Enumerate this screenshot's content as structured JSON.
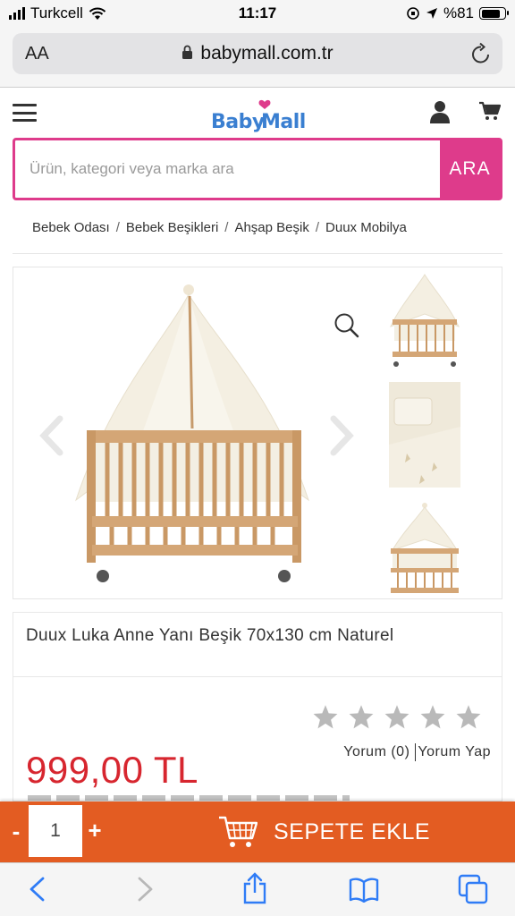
{
  "status_bar": {
    "carrier": "Turkcell",
    "time": "11:17",
    "battery": "%81"
  },
  "browser": {
    "text_size_label": "AA",
    "url": "babymall.com.tr"
  },
  "header": {
    "logo_text": "Baby Mall"
  },
  "search": {
    "placeholder": "Ürün, kategori veya marka ara",
    "button_label": "ARA",
    "accent_color": "#de3b8b"
  },
  "breadcrumb": [
    "Bebek Odası",
    "Bebek Beşikleri",
    "Ahşap Beşik",
    "Duux Mobilya"
  ],
  "product": {
    "title": "Duux Luka Anne Yanı Beşik 70x130 cm Naturel",
    "price": "999,00 TL",
    "price_color": "#d7262f",
    "rating": 0,
    "review_label": "Yorum (0)",
    "write_review_label": "Yorum Yap"
  },
  "cart_bar": {
    "quantity": "1",
    "minus_label": "-",
    "plus_label": "+",
    "add_to_cart_label": "SEPETE EKLE",
    "color": "#e35c22"
  },
  "icons": {
    "menu": "hamburger-icon",
    "user": "user-icon",
    "cart": "cart-icon",
    "zoom": "zoom-icon",
    "share": "share-icon",
    "bookmarks": "book-icon",
    "tabs": "tabs-icon"
  }
}
